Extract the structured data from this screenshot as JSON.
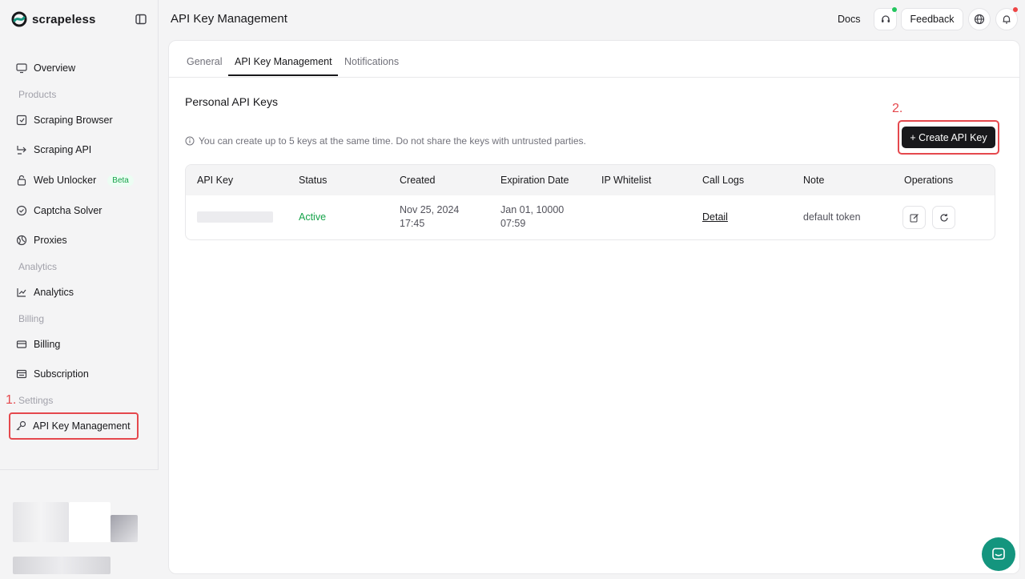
{
  "brand": {
    "name": "scrapeless",
    "logo_icon": "scrapeless-logo-icon"
  },
  "sidebar": {
    "items": [
      {
        "key": "overview",
        "label": "Overview",
        "icon": "monitor-icon"
      },
      {
        "key": "group-products",
        "label": "Products"
      },
      {
        "key": "scraping-browser",
        "label": "Scraping Browser",
        "icon": "browser-icon"
      },
      {
        "key": "scraping-api",
        "label": "Scraping API",
        "icon": "api-icon"
      },
      {
        "key": "web-unlocker",
        "label": "Web Unlocker",
        "icon": "lock-icon",
        "badge": "Beta"
      },
      {
        "key": "captcha-solver",
        "label": "Captcha Solver",
        "icon": "check-circle-icon"
      },
      {
        "key": "proxies",
        "label": "Proxies",
        "icon": "globe-icon"
      },
      {
        "key": "group-analytics",
        "label": "Analytics"
      },
      {
        "key": "analytics",
        "label": "Analytics",
        "icon": "chart-icon"
      },
      {
        "key": "group-billing",
        "label": "Billing"
      },
      {
        "key": "billing",
        "label": "Billing",
        "icon": "card-icon"
      },
      {
        "key": "subscription",
        "label": "Subscription",
        "icon": "subscription-icon"
      },
      {
        "key": "group-settings",
        "label": "Settings"
      },
      {
        "key": "api-key-management",
        "label": "API Key Management",
        "icon": "key-icon"
      }
    ]
  },
  "annotations": {
    "step1": "1.",
    "step2": "2."
  },
  "header": {
    "title": "API Key Management",
    "docs": "Docs",
    "feedback": "Feedback"
  },
  "tabs": [
    {
      "label": "General",
      "active": false
    },
    {
      "label": "API Key Management",
      "active": true
    },
    {
      "label": "Notifications",
      "active": false
    }
  ],
  "section": {
    "title": "Personal API Keys",
    "info": "You can create up to 5 keys at the same time. Do not share the keys with untrusted parties.",
    "create_button": "+ Create API Key"
  },
  "table": {
    "columns": [
      "API Key",
      "Status",
      "Created",
      "Expiration Date",
      "IP Whitelist",
      "Call Logs",
      "Note",
      "Operations"
    ],
    "rows": [
      {
        "status": "Active",
        "created_date": "Nov 25, 2024",
        "created_time": "17:45",
        "expiry_date": "Jan 01, 10000",
        "expiry_time": "07:59",
        "ip_whitelist": "",
        "call_logs": "Detail",
        "note": "default token"
      }
    ]
  },
  "colors": {
    "accent_dark": "#18181b",
    "success": "#16a34a",
    "annotation_red": "#e5484d",
    "chat": "#14957e"
  }
}
